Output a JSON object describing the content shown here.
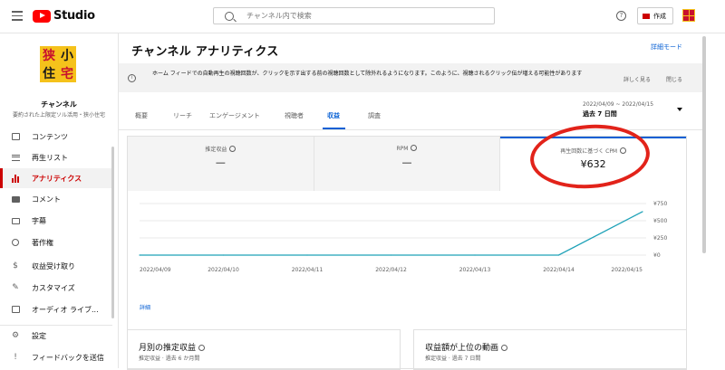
{
  "topbar": {
    "logo_text": "Studio",
    "search_placeholder": "チャンネル内で検索",
    "help_glyph": "?",
    "create_label": "作成"
  },
  "sidebar": {
    "logo_chars": [
      "狭",
      "小",
      "住",
      "宅"
    ],
    "channel_name": "チャンネル",
    "channel_sub": "要約された上限定ソル活用・狭小住宅",
    "items": [
      {
        "label": "コンテンツ",
        "icon": "content-icon"
      },
      {
        "label": "再生リスト",
        "icon": "playlist-icon"
      },
      {
        "label": "アナリティクス",
        "icon": "analytics-icon"
      },
      {
        "label": "コメント",
        "icon": "comment-icon"
      },
      {
        "label": "字幕",
        "icon": "subtitles-icon"
      },
      {
        "label": "著作権",
        "icon": "copyright-icon"
      },
      {
        "label": "収益受け取り",
        "icon": "dollar-icon"
      },
      {
        "label": "カスタマイズ",
        "icon": "magic-wand-icon"
      },
      {
        "label": "オーディオ ライブ...",
        "icon": "audio-library-icon"
      },
      {
        "label": "設定",
        "icon": "gear-icon"
      },
      {
        "label": "フィードバックを送信",
        "icon": "feedback-icon"
      }
    ]
  },
  "main": {
    "title": "チャンネル アナリティクス",
    "advanced_mode": "詳細モード",
    "banner": {
      "text": "ホーム フィードでの自動再生の視聴回数が、クリックを示す出する前の視聴回数として除外れるようになります。このように、視聴されるクリック伝が増える可能性があります",
      "button_learn": "詳しく見る",
      "button_close": "閉じる"
    },
    "tabs": [
      "概要",
      "リーチ",
      "エンゲージメント",
      "視聴者",
      "収益",
      "調査"
    ],
    "active_tab": "収益",
    "date": {
      "range": "2022/04/09 ~ 2022/04/15",
      "period": "過去 7 日間"
    },
    "metrics": [
      {
        "label": "推定収益",
        "value": "—"
      },
      {
        "label": "RPM",
        "value": "—"
      },
      {
        "label": "再生回数に基づく CPM",
        "value": "¥632"
      }
    ],
    "see_more": "詳細",
    "bottom_cards": [
      {
        "title": "月別の推定収益",
        "sub": "推定収益 · 過去 6 か月間"
      },
      {
        "title": "収益額が上位の動画",
        "sub": "推定収益 · 過去 7 日間"
      }
    ]
  },
  "chart_data": {
    "type": "line",
    "x": [
      "2022/04/09",
      "2022/04/10",
      "2022/04/11",
      "2022/04/12",
      "2022/04/13",
      "2022/04/14",
      "2022/04/15"
    ],
    "series": [
      {
        "values": [
          0,
          0,
          0,
          0,
          0,
          0,
          632
        ]
      }
    ],
    "y_ticks": [
      "¥0",
      "¥250",
      "¥500",
      "¥750"
    ],
    "ylim": [
      0,
      750
    ],
    "grid": true,
    "line_color": "#1fa2b8"
  }
}
